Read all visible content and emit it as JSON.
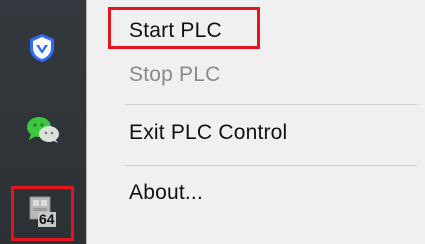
{
  "tray": {
    "icons": [
      {
        "name": "shield-icon",
        "color": "#2f6bff"
      },
      {
        "name": "wechat-icon",
        "color": "#3ec63e"
      },
      {
        "name": "plc-tray-icon",
        "badge": "64"
      }
    ]
  },
  "menu": {
    "items": [
      {
        "label": "Start PLC",
        "enabled": true
      },
      {
        "label": "Stop PLC",
        "enabled": false
      },
      {
        "label": "Exit PLC Control",
        "enabled": true
      },
      {
        "label": "About...",
        "enabled": true
      }
    ]
  },
  "highlight_color": "#e3141c"
}
